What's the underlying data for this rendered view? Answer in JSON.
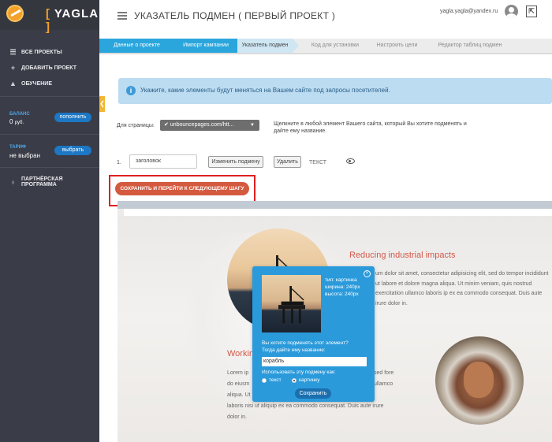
{
  "app": {
    "logo_text": "YAGLA",
    "logo_bracket_open": "[",
    "logo_bracket_close": "]"
  },
  "sidebar": {
    "items": [
      {
        "label": "ВСЕ ПРОЕКТЫ",
        "icon": "list-icon"
      },
      {
        "label": "ДОБАВИТЬ ПРОЕКТ",
        "icon": "plus-icon"
      },
      {
        "label": "ОБУЧЕНИЕ",
        "icon": "graduation-cap-icon"
      }
    ],
    "balance": {
      "label": "БАЛАНС",
      "value": "0",
      "currency": "руб.",
      "button": "пополнить"
    },
    "tariff": {
      "label": "ТАРИФ",
      "value": "не выбран",
      "button": "выбрать"
    },
    "partner": {
      "label": "ПАРТНЁРСКАЯ ПРОГРАММА",
      "icon": "partner-icon"
    },
    "collapse_glyph": "❮"
  },
  "header": {
    "title": "УКАЗАТЕЛЬ ПОДМЕН ( ПЕРВЫЙ ПРОЕКТ )",
    "email": "yagla.yagla@yandex.ru",
    "logout_glyph": "⇱"
  },
  "steps": [
    {
      "label": "Данные о проекте",
      "state": "done"
    },
    {
      "label": "Импорт кампании",
      "state": "done"
    },
    {
      "label": "Указатель подмен",
      "state": "active"
    },
    {
      "label": "Код для установки",
      "state": "todo"
    },
    {
      "label": "Настроить цели",
      "state": "todo"
    },
    {
      "label": "Редактор таблиц подмен",
      "state": "todo"
    }
  ],
  "info": {
    "icon": "i",
    "text": "Укажите, какие элементы будут меняться на Вашем сайте под запросы посетителей."
  },
  "page_selector": {
    "label": "Для страницы:",
    "value": "unbouncepages.com/htt...",
    "hint": "Щелкните в любой элемент Вашего сайта, который Вы хотите подменять и дайте ему название."
  },
  "replacement_row": {
    "number": "1.",
    "name_value": "заголовок",
    "edit_button": "Изменить подмену",
    "delete_button": "Удалить",
    "type": "ТЕКСТ"
  },
  "save_next_button": "СОХРАНИТЬ И ПЕРЕЙТИ К СЛЕДУЮЩЕМУ ШАГУ",
  "preview": {
    "heading1": "Reducing industrial impacts",
    "para1": "um dolor sit amet, consectetur adipisicing elit, sed do tempor incididunt ut labore et dolore magna aliqua. Ut minim veniam, quis nostrud exercitation ullamco laboris ip ex ea commodo consequat. Duis aute irure dolor in.",
    "heading2": "Workin",
    "para2_left": "Lorem ip do eiusm aliqua. Ut",
    "para2_right": "sed fore ullamco",
    "para2_bottom": "laboris nisi ut aliquip ex ea commodo consequat. Duis aute irure dolor in."
  },
  "popup": {
    "close_glyph": "×",
    "type_line": "тип: картинка",
    "width_line": "ширина: 240px",
    "height_line": "высота: 240px",
    "question_line1": "Вы хотите подменять этот элемент?",
    "question_line2": "Тогда дайте ему название:",
    "name_value": "корабль",
    "use_as": "Использовать эту подмену как:",
    "option_text": "текст",
    "option_image": "картинку",
    "selected": "картинку",
    "save_button": "Сохранить"
  }
}
